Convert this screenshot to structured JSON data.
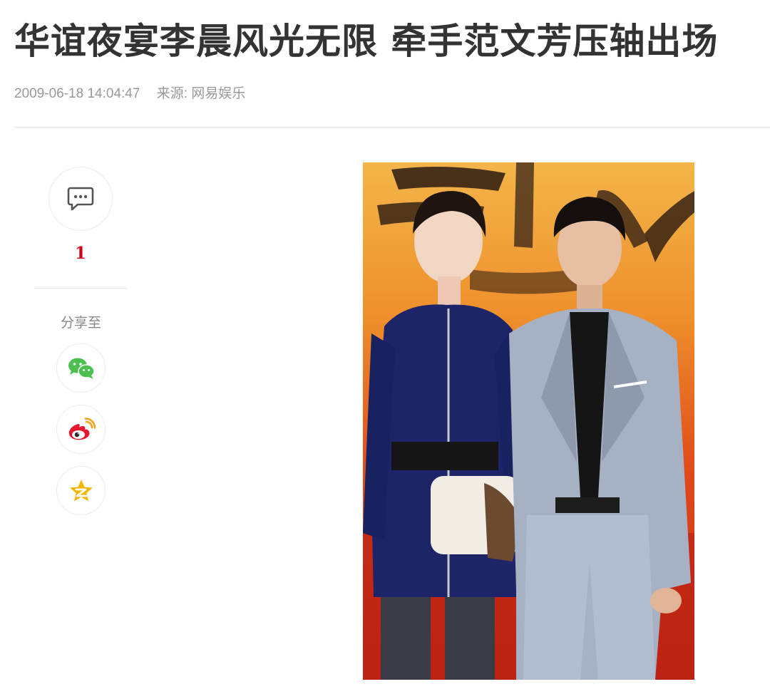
{
  "article": {
    "title": "华谊夜宴李晨风光无限 牵手范文芳压轴出场",
    "date": "2009-06-18 14:04:47",
    "source": "来源: 网易娱乐"
  },
  "sidebar": {
    "comment_count": "1",
    "share_label": "分享至",
    "share_targets": [
      "wechat",
      "weibo",
      "qzone"
    ]
  },
  "icons": {
    "comment": "comment-bubble-icon",
    "wechat": "wechat-icon",
    "weibo": "weibo-icon",
    "qzone": "qzone-icon"
  },
  "colors": {
    "comment_count": "#d0021b",
    "wechat": "#4cc04f",
    "weibo": "#e6162d",
    "qzone": "#f6b400"
  },
  "photo": {
    "alt": "photo-of-couple-at-red-carpet-event"
  }
}
